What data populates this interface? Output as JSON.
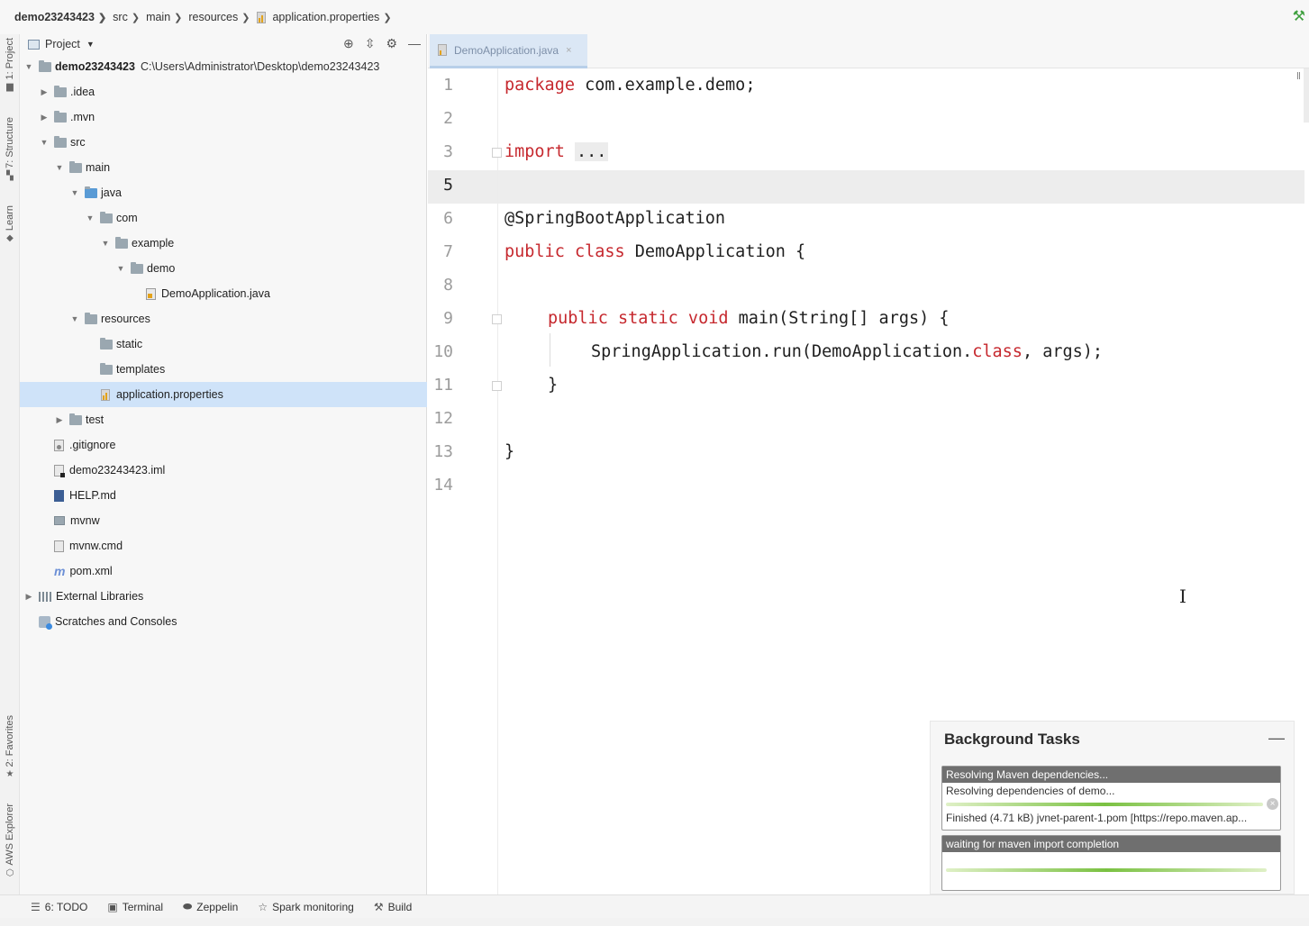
{
  "breadcrumb": {
    "items": [
      "demo23243423",
      "src",
      "main",
      "resources",
      "application.properties"
    ],
    "separator": "❯"
  },
  "left_strip": {
    "tabs": [
      "1: Project",
      "7: Structure",
      "Learn",
      "2: Favorites",
      "AWS Explorer"
    ]
  },
  "project_panel": {
    "title": "Project",
    "tree": [
      {
        "label": "demo23243423",
        "path": "C:\\Users\\Administrator\\Desktop\\demo23243423",
        "icon": "folder-icon"
      },
      {
        "label": ".idea",
        "icon": "folder-icon"
      },
      {
        "label": ".mvn",
        "icon": "folder-icon"
      },
      {
        "label": "src",
        "icon": "folder-icon"
      },
      {
        "label": "main",
        "icon": "folder-icon"
      },
      {
        "label": "java",
        "icon": "folder-icon"
      },
      {
        "label": "com",
        "icon": "folder-icon"
      },
      {
        "label": "example",
        "icon": "folder-icon"
      },
      {
        "label": "demo",
        "icon": "folder-icon"
      },
      {
        "label": "DemoApplication.java",
        "icon": "java-file-icon"
      },
      {
        "label": "resources",
        "icon": "folder-icon"
      },
      {
        "label": "static",
        "icon": "folder-icon"
      },
      {
        "label": "templates",
        "icon": "folder-icon"
      },
      {
        "label": "application.properties",
        "icon": "properties-file-icon"
      },
      {
        "label": "test",
        "icon": "folder-icon"
      },
      {
        "label": ".gitignore",
        "icon": "gitignore-file-icon"
      },
      {
        "label": "demo23243423.iml",
        "icon": "iml-file-icon"
      },
      {
        "label": "HELP.md",
        "icon": "markdown-file-icon"
      },
      {
        "label": "mvnw",
        "icon": "script-file-icon"
      },
      {
        "label": "mvnw.cmd",
        "icon": "cmd-file-icon"
      },
      {
        "label": "pom.xml",
        "icon": "maven-icon"
      },
      {
        "label": "External Libraries",
        "icon": "libraries-icon"
      },
      {
        "label": "Scratches and Consoles",
        "icon": "scratches-icon"
      }
    ]
  },
  "editor": {
    "tab_label": "DemoApplication.java",
    "line_numbers": [
      "1",
      "2",
      "3",
      "5",
      "6",
      "7",
      "8",
      "9",
      "10",
      "11",
      "12",
      "13",
      "14"
    ],
    "active_line": "5",
    "code": {
      "l1_kw": "package",
      "l1_rest": " com.example.demo;",
      "l3_kw": "import",
      "l3_dots": "...",
      "l6": "@SpringBootApplication",
      "l7_kw": "public class",
      "l7_rest": " DemoApplication {",
      "l9_kw": "public static void",
      "l9_rest": " main(String[] args) {",
      "l10_a": "SpringApplication.run(DemoApplication.",
      "l10_kw": "class",
      "l10_b": ", args);",
      "l11": "}",
      "l13": "}"
    }
  },
  "background_tasks": {
    "title": "Background Tasks",
    "task1": {
      "header": "Resolving Maven dependencies...",
      "line1": "Resolving dependencies of demo...",
      "line2": "Finished (4.71 kB) jvnet-parent-1.pom [https://repo.maven.ap...",
      "progress": 0.96
    },
    "task2": {
      "header": "waiting for maven import completion",
      "progress": 0.97
    }
  },
  "bottom_bar": {
    "tools": [
      "6: TODO",
      "Terminal",
      "Zeppelin",
      "Spark monitoring",
      "Build"
    ]
  },
  "colors": {
    "keyword": "#c6282e",
    "selection": "#cfe3f9",
    "progress": "#7ac142"
  }
}
